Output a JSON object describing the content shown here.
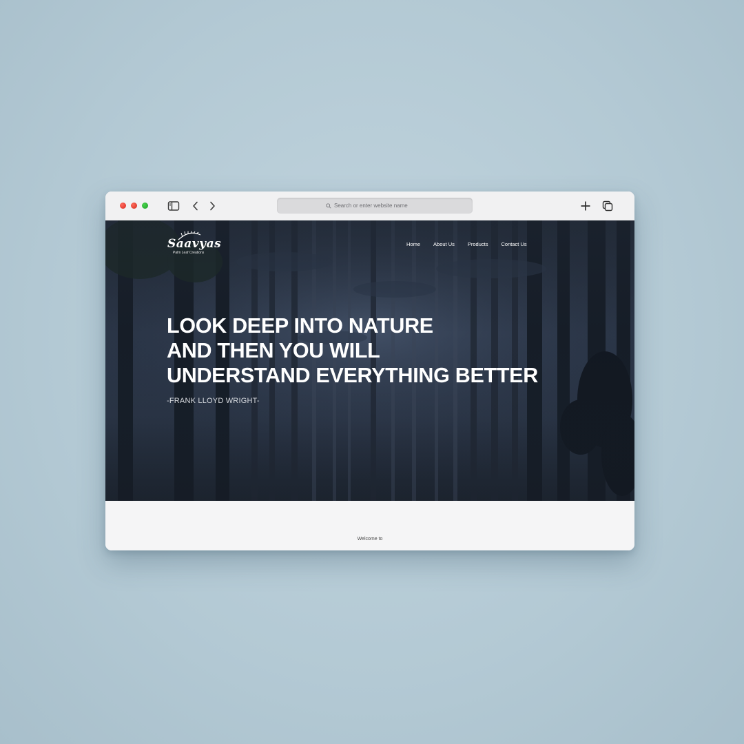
{
  "browser": {
    "address_placeholder": "Search or enter website name",
    "icons": [
      "sidebar-icon",
      "back-icon",
      "forward-icon",
      "search-icon",
      "new-tab-icon",
      "tab-overview-icon"
    ],
    "traffic_colors": {
      "close": "#e0372c",
      "minimize": "#d93a2c",
      "maximize": "#2fb83b"
    }
  },
  "site": {
    "logo": {
      "name": "Saavyas",
      "tagline": "Palm Leaf Creations"
    },
    "nav": [
      "Home",
      "About Us",
      "Products",
      "Contact Us"
    ],
    "hero": {
      "headline_lines": [
        "LOOK DEEP INTO NATURE",
        "AND THEN YOU WILL",
        "UNDERSTAND EVERYTHING BETTER"
      ],
      "attribution": "-FRANK LLOYD WRIGHT-"
    },
    "welcome_text": "Welcome to"
  },
  "colors": {
    "background": "#b7cbd5",
    "hero_overlay": "#2a3547",
    "text_on_hero": "#ffffff"
  }
}
